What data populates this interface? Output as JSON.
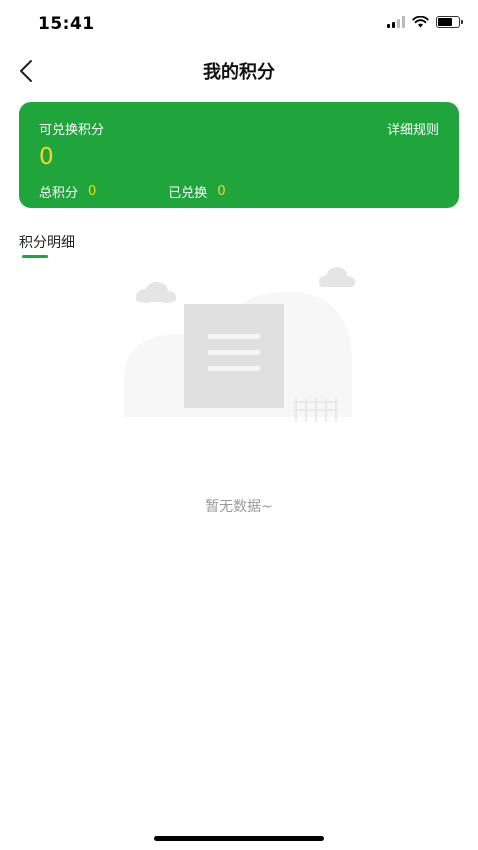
{
  "status": {
    "time": "15:41"
  },
  "nav": {
    "title": "我的积分",
    "back_icon": "chevron-left-icon"
  },
  "card": {
    "available_label": "可兑换积分",
    "rules_label": "详细规则",
    "available_value": "0",
    "total_label": "总积分",
    "total_value": "0",
    "redeemed_label": "已兑换",
    "redeemed_value": "0",
    "colors": {
      "background": "#20a53d",
      "highlight": "#ffd21f"
    }
  },
  "section": {
    "tab_label": "积分明细"
  },
  "empty": {
    "text": "暂无数据~",
    "icon": "empty-document-illustration"
  }
}
